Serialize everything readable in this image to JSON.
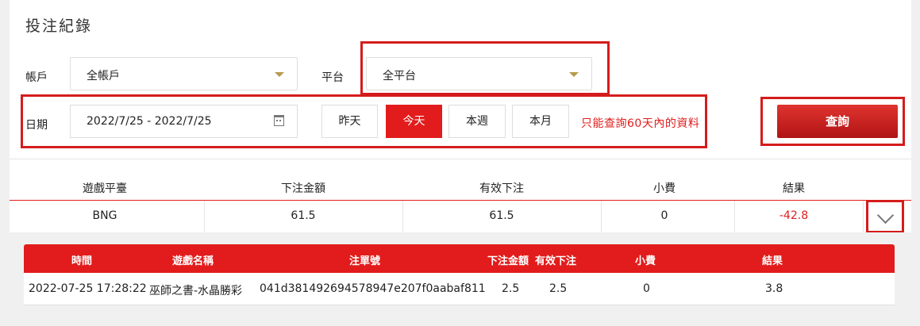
{
  "title": "投注紀錄",
  "filters": {
    "account_label": "帳戶",
    "account_value": "全帳戶",
    "platform_label": "平台",
    "platform_value": "全平台",
    "date_label": "日期",
    "date_value": "2022/7/25 - 2022/7/25",
    "quick_buttons": [
      "昨天",
      "今天",
      "本週",
      "本月"
    ],
    "active_button": "今天",
    "note": "只能查詢60天內的資料",
    "query_label": "查詢"
  },
  "summary": {
    "headers": [
      "遊戲平臺",
      "下注金額",
      "有效下注",
      "小費",
      "結果"
    ],
    "row": [
      "BNG",
      "61.5",
      "61.5",
      "0",
      "-42.8"
    ]
  },
  "detail": {
    "headers": [
      "時間",
      "遊戲名稱",
      "注單號",
      "下注金額",
      "有效下注",
      "小費",
      "結果"
    ],
    "row": [
      "2022-07-25 17:28:22",
      "巫師之書-水晶勝彩",
      "041d381492694578947e207f0aabaf811",
      "2.5",
      "2.5",
      "0",
      "3.8"
    ]
  },
  "colors": {
    "accent": "#e21c1c",
    "negative": "#e21c1c",
    "caret": "#b89a4e"
  },
  "icons": [
    "chevron-down-icon",
    "calendar-icon",
    "dropdown-caret-icon"
  ]
}
